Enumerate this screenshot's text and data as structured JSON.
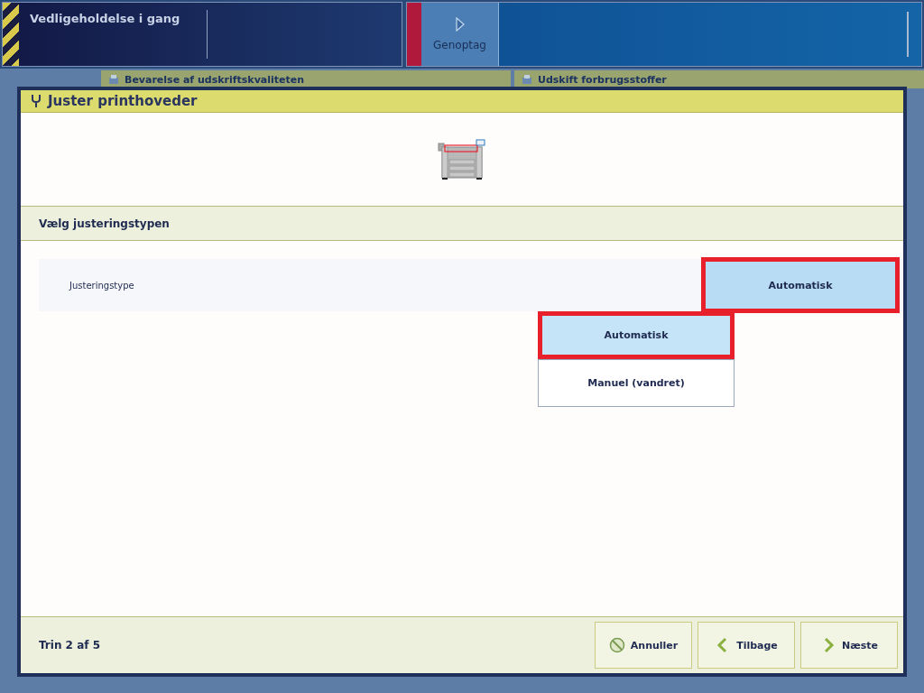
{
  "status_panel": {
    "title": "Vedligeholdelse i gang"
  },
  "resume_button": {
    "label": "Genoptag"
  },
  "background_tabs": [
    {
      "label": "Bevarelse af udskriftskvaliteten"
    },
    {
      "label": "Udskift forbrugsstoffer"
    }
  ],
  "dialog": {
    "title": "Juster printhoveder",
    "section": "Vælg justeringstypen",
    "setting": {
      "label": "Justeringstype",
      "value": "Automatisk"
    },
    "dropdown": [
      {
        "label": "Automatisk",
        "selected": true
      },
      {
        "label": "Manuel (vandret)",
        "selected": false
      }
    ],
    "step": "Trin 2 af 5",
    "buttons": [
      {
        "kind": "cancel",
        "label": "Annuller"
      },
      {
        "kind": "back",
        "label": "Tilbage"
      },
      {
        "kind": "next",
        "label": "Næste"
      }
    ]
  }
}
